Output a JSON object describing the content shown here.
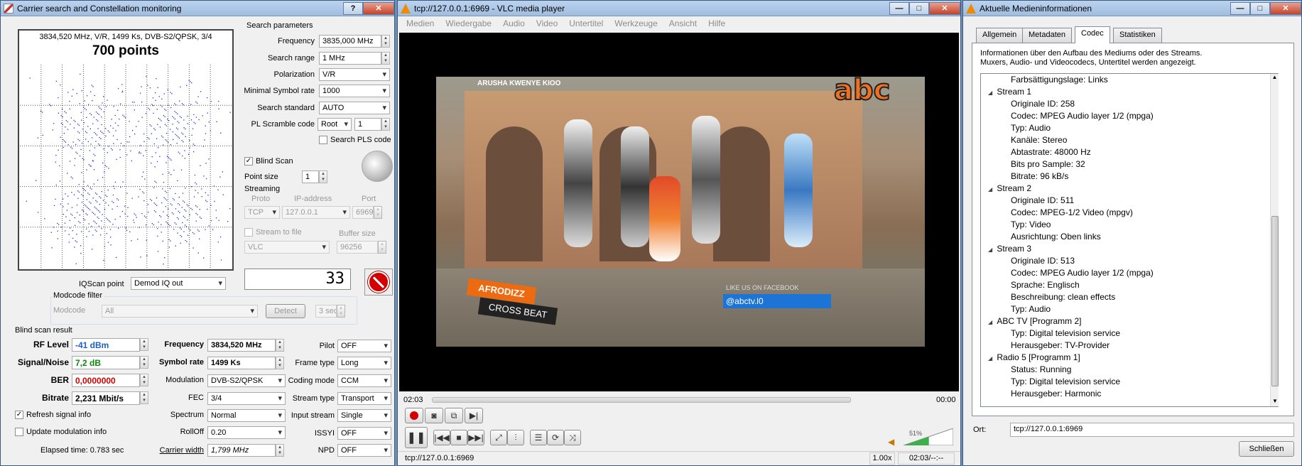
{
  "carrier": {
    "title": "Carrier search and Constellation monitoring",
    "const_header": "3834,520 MHz, V/R, 1499 Ks, DVB-S2/QPSK, 3/4",
    "points": "700 points",
    "search_params_title": "Search parameters",
    "frequency_label": "Frequency",
    "frequency_value": "3835,000 MHz",
    "search_range_label": "Search range",
    "search_range_value": "1 MHz",
    "polarization_label": "Polarization",
    "polarization_value": "V/R",
    "min_sr_label": "Minimal Symbol rate",
    "min_sr_value": "1000",
    "search_standard_label": "Search standard",
    "search_standard_value": "AUTO",
    "pl_scramble_label": "PL Scramble code",
    "pl_scramble_mode": "Root",
    "pl_scramble_value": "1",
    "search_pls_label": "Search PLS code",
    "blind_scan_label": "Blind Scan",
    "point_size_label": "Point size",
    "point_size_value": "1",
    "streaming_label": "Streaming",
    "proto_label": "Proto",
    "ip_label": "IP-address",
    "port_label": "Port",
    "proto_value": "TCP",
    "ip_value": "127.0.0.1",
    "port_value": "6969",
    "stream_to_file_label": "Stream to file",
    "buffer_size_label": "Buffer size",
    "file_format_value": "VLC",
    "buffer_size_value": "96256",
    "signal_display": "33",
    "iqscan_label": "IQScan point",
    "iqscan_value": "Demod IQ out",
    "modcode_filter_label": "Modcode filter",
    "modcode_label": "Modcode",
    "modcode_value": "All",
    "detect_label": "Detect",
    "detect_time": "3 sec",
    "blind_result_title": "Blind scan result",
    "rf_level_label": "RF Level",
    "rf_level_value": "-41 dBm",
    "snr_label": "Signal/Noise",
    "snr_value": "7,2 dB",
    "ber_label": "BER",
    "ber_value": "0,0000000",
    "bitrate_label": "Bitrate",
    "bitrate_value": "2,231 Mbit/s",
    "res_freq_label": "Frequency",
    "res_freq_value": "3834,520 MHz",
    "res_sr_label": "Symbol rate",
    "res_sr_value": "1499 Ks",
    "modulation_label": "Modulation",
    "modulation_value": "DVB-S2/QPSK",
    "fec_label": "FEC",
    "fec_value": "3/4",
    "spectrum_label": "Spectrum",
    "spectrum_value": "Normal",
    "rolloff_label": "RollOff",
    "rolloff_value": "0.20",
    "carrier_width_label": "Carrier width",
    "carrier_width_value": "1,799 MHz",
    "pilot_label": "Pilot",
    "pilot_value": "OFF",
    "frame_type_label": "Frame type",
    "frame_type_value": "Long",
    "coding_mode_label": "Coding mode",
    "coding_mode_value": "CCM",
    "stream_type_label": "Stream type",
    "stream_type_value": "Transport",
    "input_stream_label": "Input stream",
    "input_stream_value": "Single",
    "issyi_label": "ISSYI",
    "issyi_value": "OFF",
    "npd_label": "NPD",
    "npd_value": "OFF",
    "refresh_label": "Refresh signal info",
    "update_mod_label": "Update modulation info",
    "elapsed_label": "Elapsed time: 0.783 sec",
    "colors": {
      "rf": "#1f5fc8",
      "snr": "#0a8a0a",
      "ber": "#d00000",
      "stop": "#d40000"
    }
  },
  "vlc": {
    "title": "tcp://127.0.0.1:6969 - VLC media player",
    "menu": [
      "Medien",
      "Wiedergabe",
      "Audio",
      "Video",
      "Untertitel",
      "Werkzeuge",
      "Ansicht",
      "Hilfe"
    ],
    "video_overlay_top": "ARUSHA KWENYE KIOO",
    "video_logo": "abc",
    "video_lower_1": "AFRODIZZ",
    "video_lower_2": "CROSS BEAT",
    "video_fb": "LIKE US ON FACEBOOK",
    "video_handle": "@abctv.l0",
    "time_elapsed": "02:03",
    "time_total": "00:00",
    "volume": "51%",
    "status_url": "tcp://127.0.0.1:6969",
    "speed": "1.00x",
    "time_status": "02:03/--:--"
  },
  "info": {
    "title": "Aktuelle Medieninformationen",
    "tabs": [
      "Allgemein",
      "Metadaten",
      "Codec",
      "Statistiken"
    ],
    "description": "Informationen über den Aufbau des Mediums oder des Streams. Muxers, Audio- und Videocodecs, Untertitel werden angezeigt.",
    "tree": [
      {
        "level": 2,
        "text": "Farbsättigungslage: Links"
      },
      {
        "level": 1,
        "text": "Stream 1"
      },
      {
        "level": 2,
        "text": "Originale ID: 258"
      },
      {
        "level": 2,
        "text": "Codec: MPEG Audio layer 1/2 (mpga)"
      },
      {
        "level": 2,
        "text": "Typ: Audio"
      },
      {
        "level": 2,
        "text": "Kanäle: Stereo"
      },
      {
        "level": 2,
        "text": "Abtastrate: 48000 Hz"
      },
      {
        "level": 2,
        "text": "Bits pro Sample: 32"
      },
      {
        "level": 2,
        "text": "Bitrate: 96 kB/s"
      },
      {
        "level": 1,
        "text": "Stream 2"
      },
      {
        "level": 2,
        "text": "Originale ID: 511"
      },
      {
        "level": 2,
        "text": "Codec: MPEG-1/2 Video (mpgv)"
      },
      {
        "level": 2,
        "text": "Typ: Video"
      },
      {
        "level": 2,
        "text": "Ausrichtung: Oben links"
      },
      {
        "level": 1,
        "text": "Stream 3"
      },
      {
        "level": 2,
        "text": "Originale ID: 513"
      },
      {
        "level": 2,
        "text": "Codec: MPEG Audio layer 1/2 (mpga)"
      },
      {
        "level": 2,
        "text": "Sprache: Englisch"
      },
      {
        "level": 2,
        "text": "Beschreibung: clean effects"
      },
      {
        "level": 2,
        "text": "Typ: Audio"
      },
      {
        "level": 1,
        "text": "ABC TV [Programm 2]"
      },
      {
        "level": 2,
        "text": "Typ: Digital television service"
      },
      {
        "level": 2,
        "text": "Herausgeber: TV-Provider"
      },
      {
        "level": 1,
        "text": "Radio 5 [Programm 1]"
      },
      {
        "level": 2,
        "text": "Status: Running"
      },
      {
        "level": 2,
        "text": "Typ: Digital television service"
      },
      {
        "level": 2,
        "text": "Herausgeber: Harmonic"
      }
    ],
    "ort_label": "Ort:",
    "ort_value": "tcp://127.0.0.1:6969",
    "close_label": "Schließen"
  }
}
